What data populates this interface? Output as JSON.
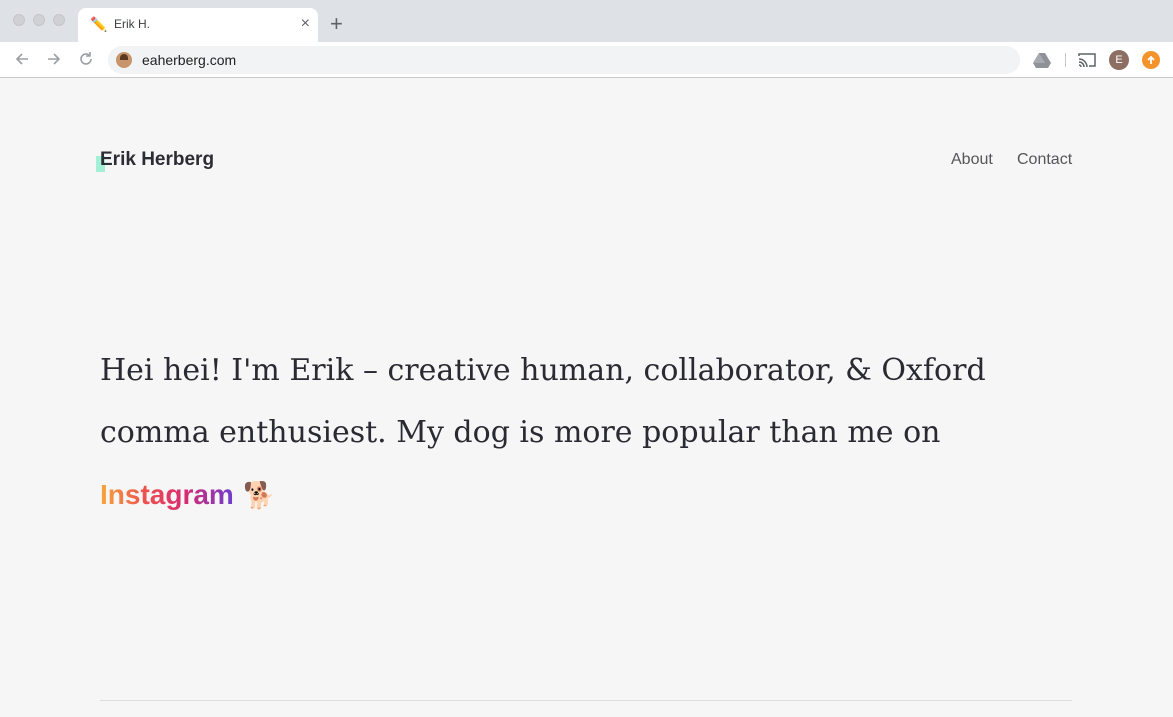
{
  "browser": {
    "tab": {
      "favicon": "✏️",
      "title": "Erik H."
    },
    "new_tab_symbol": "+",
    "close_symbol": "×",
    "url": "eaherberg.com",
    "profile_initial": "E",
    "icons": [
      "back-arrow-icon",
      "forward-arrow-icon",
      "reload-icon",
      "drive-icon",
      "cast-icon",
      "profile-avatar",
      "update-icon"
    ]
  },
  "site": {
    "logo": "Erik Herberg",
    "nav": [
      "About",
      "Contact"
    ],
    "hero": {
      "text": "Hei hei! I'm Erik – creative human, collaborator, & Oxford comma enthusiest. My dog is more popular than me on ",
      "link": "Instagram",
      "emoji": "🐕"
    }
  }
}
